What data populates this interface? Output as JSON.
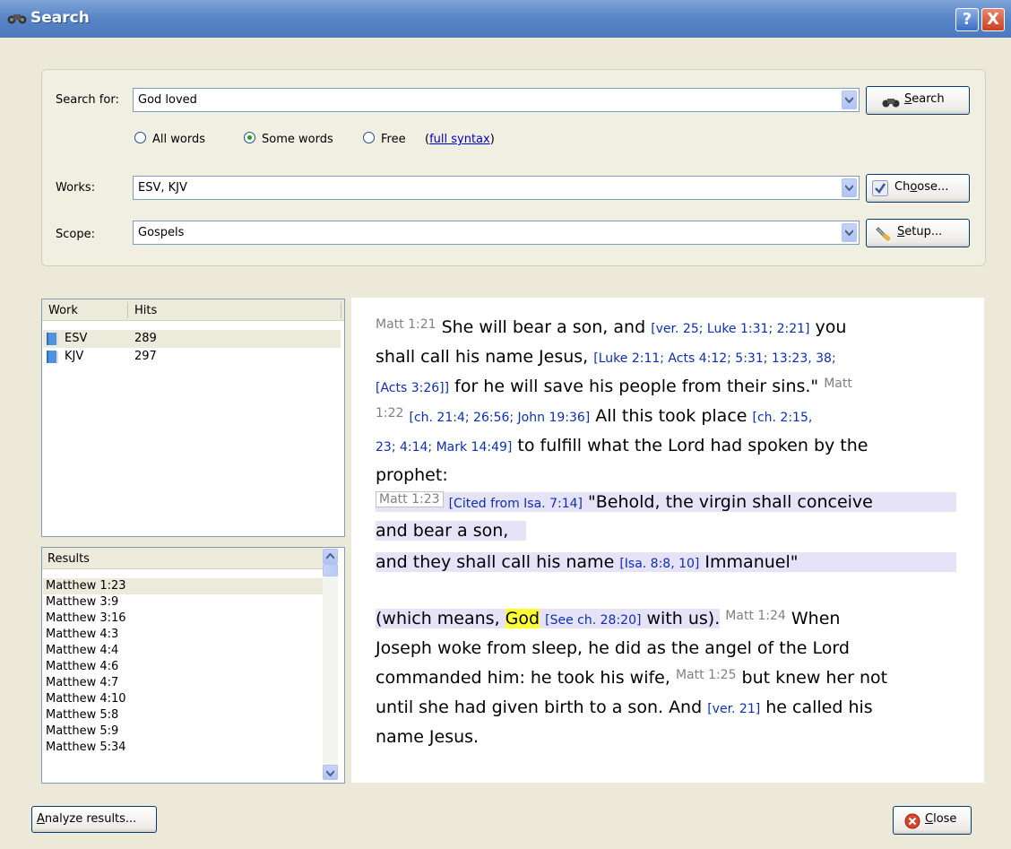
{
  "window": {
    "title": "Search",
    "help": "?",
    "close": "X"
  },
  "search": {
    "label": "Search for:",
    "value": "God loved",
    "button": "Search",
    "button_accel": "S",
    "button_rest": "earch",
    "options": [
      "All words",
      "Some words",
      "Free"
    ],
    "selected": "Some words",
    "full_syntax": "full syntax",
    "paren_open": "(",
    "paren_close": ")"
  },
  "works": {
    "label": "Works:",
    "value": "ESV, KJV",
    "button_a": "Ch",
    "button_accel": "o",
    "button_b": "ose..."
  },
  "scope": {
    "label": "Scope:",
    "value": "Gospels",
    "button_accel": "S",
    "button_rest": "etup..."
  },
  "works_table": {
    "headers": [
      "Work",
      "Hits"
    ],
    "rows": [
      {
        "work": "ESV",
        "hits": "289"
      },
      {
        "work": "KJV",
        "hits": "297"
      }
    ]
  },
  "results": {
    "header": "Results",
    "items": [
      "Matthew 1:23",
      "Matthew 3:9",
      "Matthew 3:16",
      "Matthew 4:3",
      "Matthew 4:4",
      "Matthew 4:6",
      "Matthew 4:7",
      "Matthew 4:10",
      "Matthew 5:8",
      "Matthew 5:9",
      "Matthew 5:34"
    ]
  },
  "passage": {
    "l1": {
      "v": "Matt 1:21",
      "t1": " She will bear a son, and ",
      "x1": "[ver. 25; Luke 1:31; 2:21]",
      "t2": " you"
    },
    "l2": {
      "t1": "shall call his name Jesus, ",
      "x1": "[Luke 2:11; Acts 4:12; 5:31; 13:23, 38;"
    },
    "l3": {
      "x1": "[Acts 3:26]]",
      "t1": " for he will save his people from their sins.\" ",
      "v": "Matt"
    },
    "l4": {
      "v": "1:22",
      "x1": "[ch. 21:4; 26:56; John 19:36]",
      "t1": " All this took place ",
      "x2": "[ch. 2:15,"
    },
    "l5": {
      "x1": "23; 4:14; Mark 14:49]",
      "t1": " to fulfill what the Lord had spoken by the"
    },
    "l6": {
      "t1": "prophet:"
    },
    "l7": {
      "v": "Matt 1:23",
      "x1": "[Cited from Isa. 7:14]",
      "t1": " \"Behold, the virgin shall conceive"
    },
    "l8": {
      "t1": "and bear a son,"
    },
    "l9": {
      "t1": "and they shall call his name ",
      "x1": "[Isa. 8:8, 10]",
      "t2": " Immanuel\""
    },
    "l10": {
      "t1": "(which means, ",
      "g": "God",
      "x1": "[See ch. 28:20]",
      "t2": " with us).",
      "v": "Matt 1:24",
      "t3": " When"
    },
    "l11": {
      "t1": "Joseph woke from sleep, he did as the angel of the Lord"
    },
    "l12": {
      "t1": "commanded him: he took his wife, ",
      "v": "Matt 1:25",
      "t2": " but knew her not"
    },
    "l13": {
      "t1": "until she had given birth to a son. And ",
      "x1": "[ver. 21]",
      "t2": " he called his"
    },
    "l14": {
      "t1": "name Jesus."
    }
  },
  "footer": {
    "analyze_accel": "A",
    "analyze_rest": "nalyze results...",
    "close_accel": "C",
    "close_rest": "lose"
  }
}
